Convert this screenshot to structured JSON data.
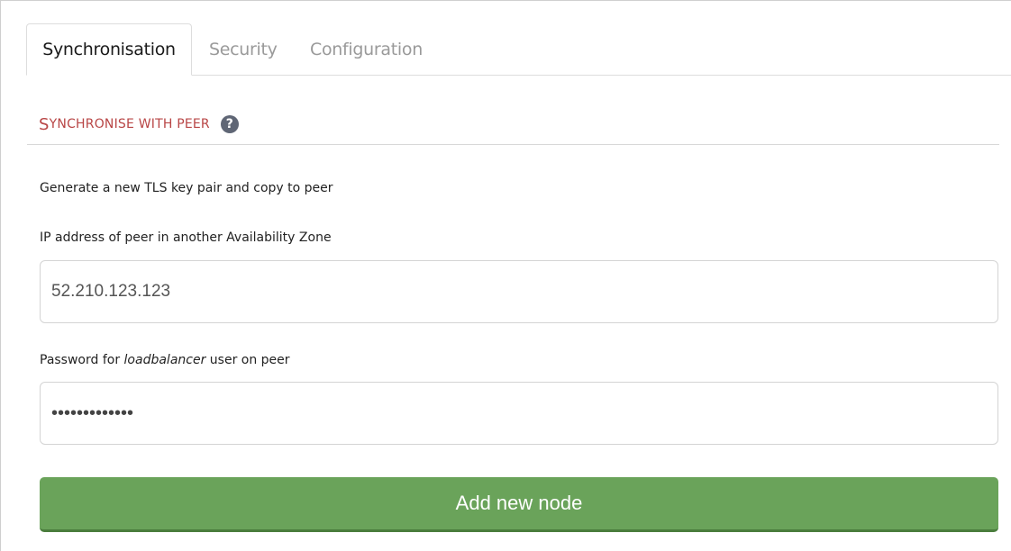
{
  "tabs": [
    {
      "label": "Synchronisation",
      "active": true
    },
    {
      "label": "Security",
      "active": false
    },
    {
      "label": "Configuration",
      "active": false
    }
  ],
  "section": {
    "title_first": "S",
    "title_rest": "YNCHRONISE WITH PEER",
    "help_icon": "question-circle-icon",
    "help_glyph": "?"
  },
  "description": "Generate a new TLS key pair and copy to peer",
  "ip_field": {
    "label": "IP address of peer in another Availability Zone",
    "value": "52.210.123.123"
  },
  "password_field": {
    "label_prefix": "Password for ",
    "label_user": "loadbalancer",
    "label_suffix": " user on peer",
    "masked_value": "•••••••••••••"
  },
  "submit_button": {
    "label": "Add new node"
  },
  "colors": {
    "accent_red": "#b84545",
    "button_green": "#6aa35a",
    "button_green_border": "#4a7d3d"
  }
}
